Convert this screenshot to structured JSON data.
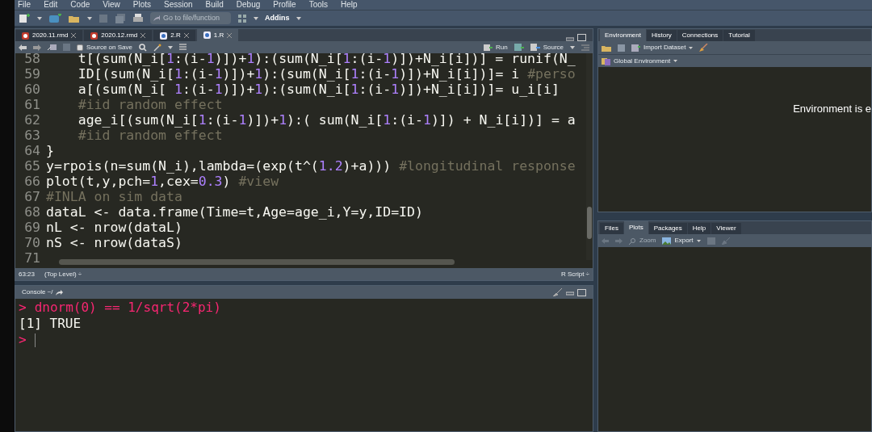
{
  "menu": [
    "File",
    "Edit",
    "Code",
    "View",
    "Plots",
    "Session",
    "Build",
    "Debug",
    "Profile",
    "Tools",
    "Help"
  ],
  "toolbar": {
    "goto_placeholder": "Go to file/function",
    "addins": "Addins"
  },
  "editor": {
    "tabs": [
      {
        "label": "2020.11.rmd",
        "kind": "rmd",
        "selected": false
      },
      {
        "label": "2020.12.rmd",
        "kind": "rmd",
        "selected": false
      },
      {
        "label": "2.R",
        "kind": "r",
        "selected": false
      },
      {
        "label": "1.R",
        "kind": "r",
        "selected": true
      }
    ],
    "source_on_save": {
      "label": "Source on Save",
      "checked": false
    },
    "run": "Run",
    "source": "Source",
    "lines": [
      {
        "number": "58",
        "text": "    t[(sum(N_i[1:(i-1)])+1):(sum(N_i[1:(i-1)])+N_i[i])] = runif(N_"
      },
      {
        "number": "59",
        "text": "    ID[(sum(N_i[1:(i-1)])+1):(sum(N_i[1:(i-1)])+N_i[i])]= i #perso"
      },
      {
        "number": "60",
        "text": "    a[(sum(N_i[ 1:(i-1)])+1):(sum(N_i[1:(i-1)])+N_i[i])]= u_i[i]"
      },
      {
        "number": "61",
        "text": "    #iid random effect"
      },
      {
        "number": "62",
        "text": "    age_i[(sum(N_i[1:(i-1)])+1):( sum(N_i[1:(i-1)]) + N_i[i])] = a"
      },
      {
        "number": "63",
        "text": "    #iid random effect"
      },
      {
        "number": "64",
        "text": "}"
      },
      {
        "number": "65",
        "text": "y=rpois(n=sum(N_i),lambda=(exp(t^(1.2)+a))) #longitudinal response"
      },
      {
        "number": "66",
        "text": "plot(t,y,pch=1,cex=0.3) #view"
      },
      {
        "number": "67",
        "text": "#INLA on sim data"
      },
      {
        "number": "68",
        "text": "dataL <- data.frame(Time=t,Age=age_i,Y=y,ID=ID)"
      },
      {
        "number": "69",
        "text": "nL <- nrow(dataL)"
      },
      {
        "number": "70",
        "text": "nS <- nrow(dataS)"
      },
      {
        "number": "71"
      }
    ],
    "status": {
      "position": "63:23",
      "scope": "(Top Level) ÷",
      "file_type": "R Script ÷"
    }
  },
  "console": {
    "title": "Console ~/",
    "lines": [
      {
        "kind": "input",
        "prompt": ">",
        "text": "dnorm(0) == 1/sqrt(2*pi)"
      },
      {
        "kind": "output",
        "text": "[1] TRUE"
      },
      {
        "kind": "prompt",
        "prompt": ">"
      }
    ]
  },
  "environment": {
    "tabs": [
      {
        "label": "Environment",
        "selected": true
      },
      {
        "label": "History",
        "selected": false
      },
      {
        "label": "Connections",
        "selected": false
      },
      {
        "label": "Tutorial",
        "selected": false
      }
    ],
    "import": "Import Dataset",
    "scope": "Global Environment",
    "message": "Environment is e"
  },
  "files": {
    "tabs": [
      {
        "label": "Files",
        "selected": false
      },
      {
        "label": "Plots",
        "selected": true
      },
      {
        "label": "Packages",
        "selected": false
      },
      {
        "label": "Help",
        "selected": false
      },
      {
        "label": "Viewer",
        "selected": false
      }
    ],
    "zoom": {
      "label": "Zoom",
      "disabled": true
    },
    "export": "Export"
  }
}
